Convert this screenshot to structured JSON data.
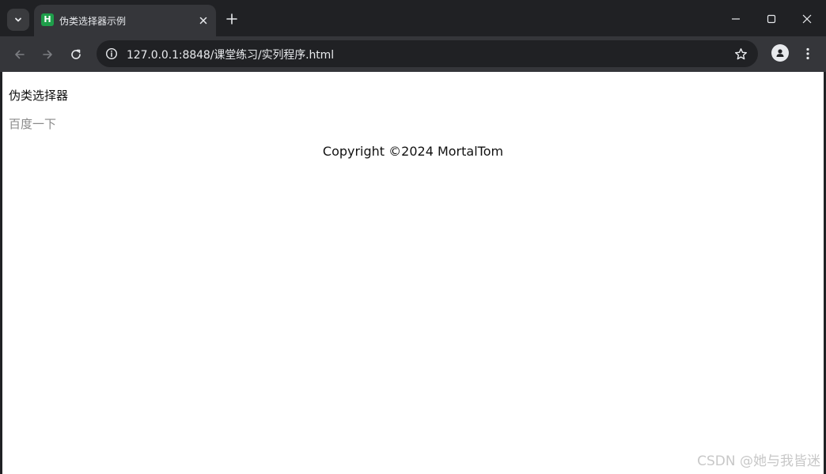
{
  "browser": {
    "tab": {
      "title": "伪类选择器示例",
      "favicon_letter": "H",
      "favicon_color": "#1e9e4a"
    },
    "address_bar": {
      "url": "127.0.0.1:8848/课堂练习/实列程序.html"
    },
    "icons": {
      "tab_search": "chevron-down-icon",
      "tab_close": "close-icon",
      "new_tab": "plus-icon",
      "minimize": "minimize-icon",
      "maximize": "maximize-icon",
      "close_window": "close-icon",
      "back": "arrow-left-icon",
      "forward": "arrow-right-icon",
      "reload": "reload-icon",
      "site_info": "info-icon",
      "bookmark": "star-icon",
      "profile": "person-icon",
      "menu": "kebab-menu-icon"
    },
    "colors": {
      "frame": "#202124",
      "toolbar": "#35363a",
      "text": "#e8eaed"
    }
  },
  "page": {
    "heading": "伪类选择器",
    "link_label": "百度一下",
    "link_color": "#8a8a8a",
    "footer": "Copyright ©2024 MortalTom",
    "background": "#ffffff"
  },
  "watermark": "CSDN @她与我皆迷"
}
